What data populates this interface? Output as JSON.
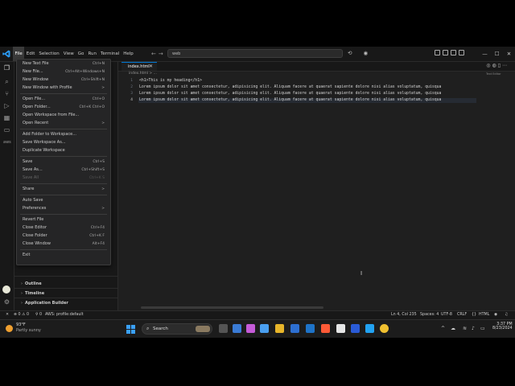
{
  "titlebar": {
    "menu": [
      "File",
      "Edit",
      "Selection",
      "View",
      "Go",
      "Run",
      "Terminal",
      "Help"
    ],
    "command_center": "web"
  },
  "tab": {
    "label": "index.html"
  },
  "breadcrumb": "index.html > ...",
  "minimap_label": "Text Editor",
  "editor": {
    "line_numbers": [
      "1",
      "2",
      "3",
      "4"
    ],
    "lines": [
      "<h1>This is my heading</h1>",
      "Lorem ipsum dolor sit amet consectetur, adipisicing elit. Aliquam facere at quaerat sapiente dolore nisi alias voluptatum, quisqua",
      "Lorem ipsum dolor sit amet consectetur, adipisicing elit. Aliquam facere at quaerat sapiente dolore nisi alias voluptatum, quisqua",
      "Lorem ipsum dolor sit amet consectetur, adipisicing elit. Aliquam facere at quaerat sapiente dolore nisi alias voluptatum, quisqua"
    ]
  },
  "file_menu": [
    {
      "label": "New Text File",
      "shortcut": "Ctrl+N"
    },
    {
      "label": "New File...",
      "shortcut": "Ctrl+Alt+Windows+N"
    },
    {
      "label": "New Window",
      "shortcut": "Ctrl+Shift+N"
    },
    {
      "label": "New Window with Profile",
      "shortcut": ">"
    },
    {
      "label": "Open File...",
      "shortcut": "Ctrl+O"
    },
    {
      "label": "Open Folder...",
      "shortcut": "Ctrl+K Ctrl+O"
    },
    {
      "label": "Open Workspace from File...",
      "shortcut": ""
    },
    {
      "label": "Open Recent",
      "shortcut": ">"
    },
    {
      "label": "Add Folder to Workspace...",
      "shortcut": ""
    },
    {
      "label": "Save Workspace As...",
      "shortcut": ""
    },
    {
      "label": "Duplicate Workspace",
      "shortcut": ""
    },
    {
      "label": "Save",
      "shortcut": "Ctrl+S"
    },
    {
      "label": "Save As...",
      "shortcut": "Ctrl+Shift+S"
    },
    {
      "label": "Save All",
      "shortcut": "Ctrl+K S",
      "disabled": true
    },
    {
      "label": "Share",
      "shortcut": ">"
    },
    {
      "label": "Auto Save",
      "shortcut": ""
    },
    {
      "label": "Preferences",
      "shortcut": ">"
    },
    {
      "label": "Revert File",
      "shortcut": ""
    },
    {
      "label": "Close Editor",
      "shortcut": "Ctrl+F4"
    },
    {
      "label": "Close Folder",
      "shortcut": "Ctrl+K F"
    },
    {
      "label": "Close Window",
      "shortcut": "Alt+F4"
    },
    {
      "label": "Exit",
      "shortcut": ""
    }
  ],
  "sidebar_panels": [
    "Outline",
    "Timeline",
    "Application Builder"
  ],
  "statusbar": {
    "problems": "⊗ 0 ⚠ 0",
    "ports": "⚲ 0",
    "aws": "AWS: profile:default",
    "position": "Ln 4, Col 235",
    "spaces": "Spaces: 4",
    "encoding": "UTF-8",
    "eol": "CRLF",
    "language": "HTML"
  },
  "taskbar": {
    "weather_temp": "93°F",
    "weather_desc": "Partly sunny",
    "search": "Search",
    "time": "3:37 PM",
    "date": "8/23/2024"
  },
  "colors": {
    "accent": "#0078d4",
    "background": "#1f1f1f"
  }
}
